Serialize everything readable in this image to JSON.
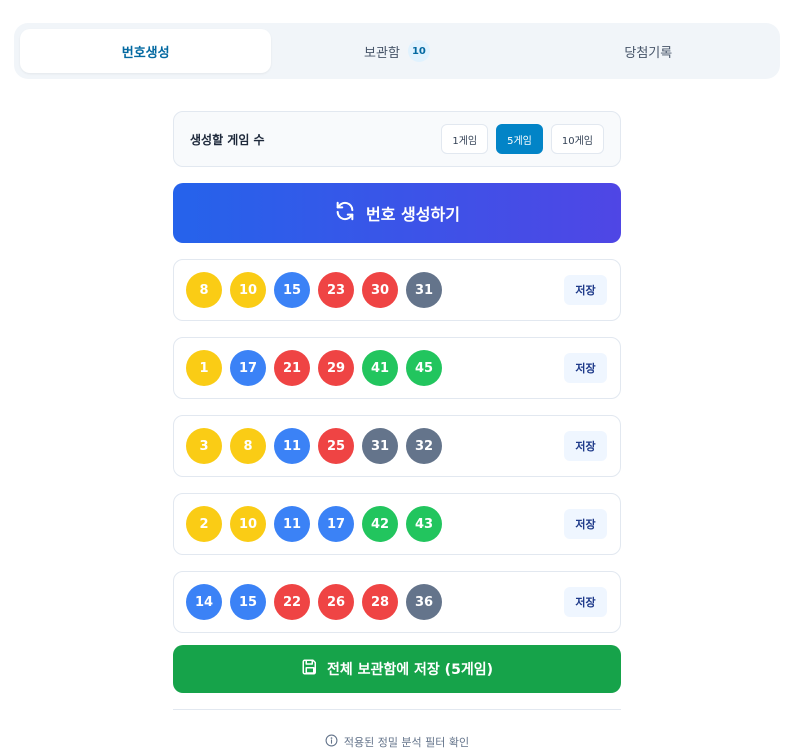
{
  "tabs": [
    {
      "label": "번호생성"
    },
    {
      "label": "보관함",
      "badge": "10"
    },
    {
      "label": "당첨기록"
    }
  ],
  "count_selector": {
    "label": "생성할 게임 수",
    "options": [
      "1게임",
      "5게임",
      "10게임"
    ],
    "selected": "5게임"
  },
  "generate_button": {
    "label": "번호 생성하기",
    "icon": "refresh-icon"
  },
  "games": [
    {
      "numbers": [
        "8",
        "10",
        "15",
        "23",
        "30",
        "31"
      ],
      "save_label": "저장"
    },
    {
      "numbers": [
        "1",
        "17",
        "21",
        "29",
        "41",
        "45"
      ],
      "save_label": "저장"
    },
    {
      "numbers": [
        "3",
        "8",
        "11",
        "25",
        "31",
        "32"
      ],
      "save_label": "저장"
    },
    {
      "numbers": [
        "2",
        "10",
        "11",
        "17",
        "42",
        "43"
      ],
      "save_label": "저장"
    },
    {
      "numbers": [
        "14",
        "15",
        "22",
        "26",
        "28",
        "36"
      ],
      "save_label": "저장"
    }
  ],
  "ball_colors": {
    "1-10": "#facc15",
    "11-20": "#3b82f6",
    "21-30": "#ef4444",
    "31-40": "#64748b",
    "41-45": "#22c55e"
  },
  "save_all_button": {
    "label": "전체 보관함에 저장 (5게임)",
    "icon": "save-icon"
  },
  "filter_link": {
    "label": "적용된 정밀 분석 필터 확인",
    "icon": "info-icon"
  }
}
